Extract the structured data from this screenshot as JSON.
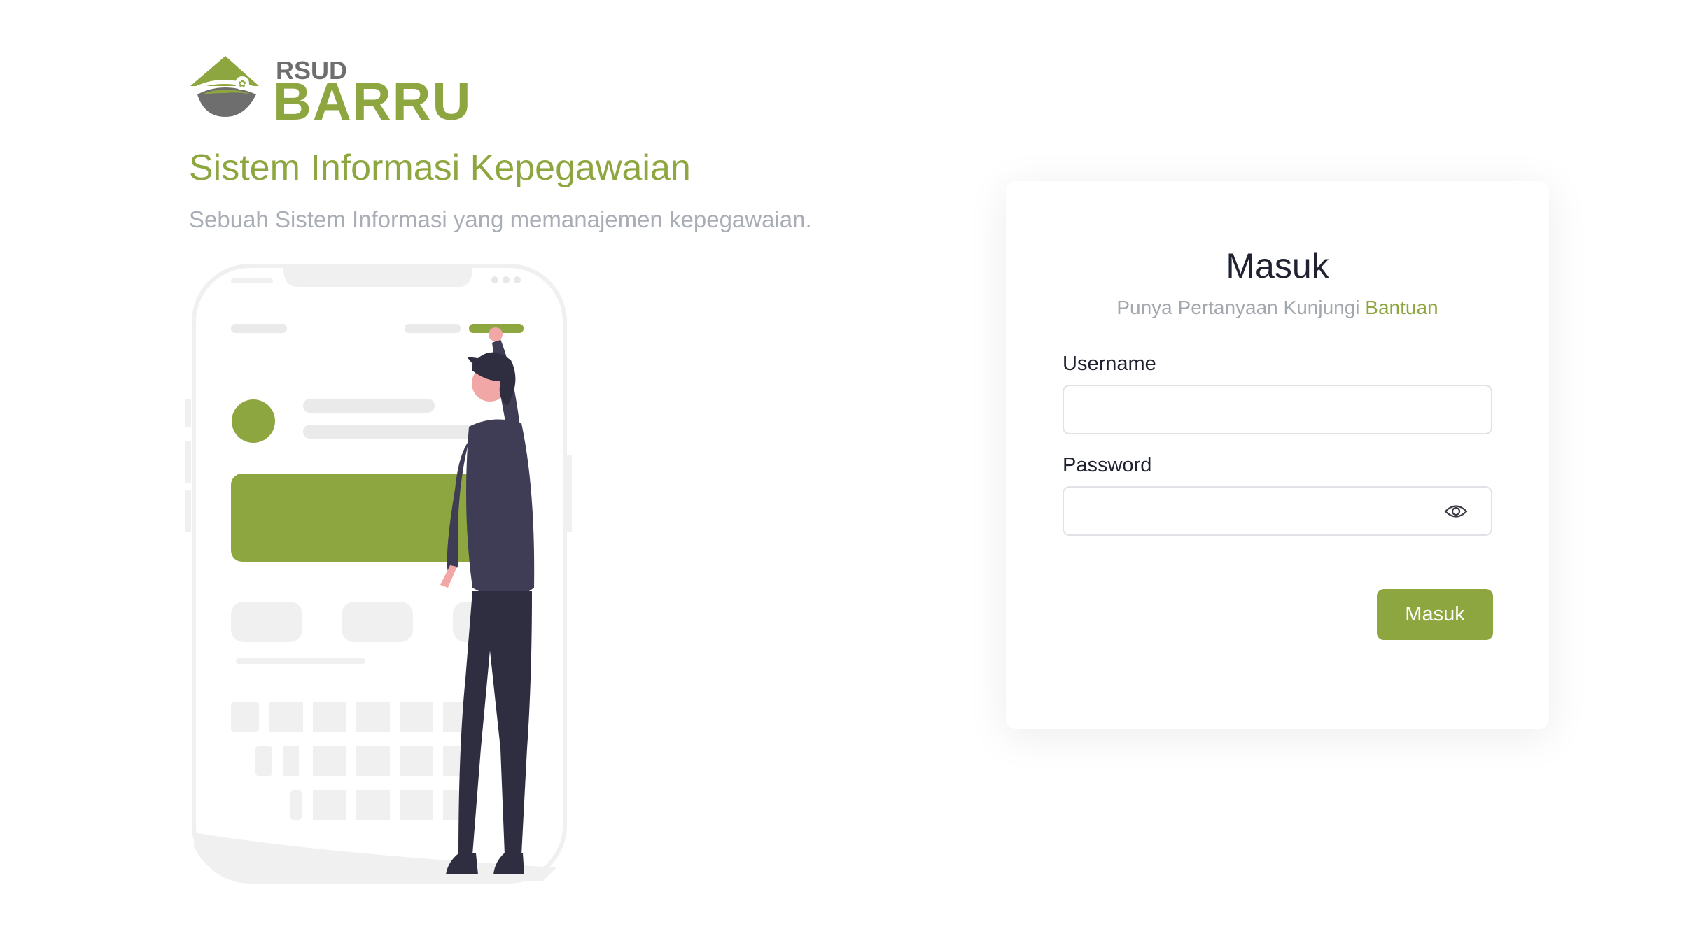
{
  "brand": {
    "logo_small_text": "RSUD",
    "logo_large_text": "BARRU",
    "logo_icon": "rsud-barru-emblem-icon",
    "accent_color": "#8ea63f",
    "gray_color": "#6e6e6e"
  },
  "hero": {
    "title": "Sistem Informasi Kepegawaian",
    "subtitle": "Sebuah Sistem Informasi yang memanajemen kepegawaian."
  },
  "login": {
    "heading": "Masuk",
    "help_text": "Punya Pertanyaan Kunjungi",
    "help_link": "Bantuan",
    "username_label": "Username",
    "username_value": "",
    "username_placeholder": "",
    "password_label": "Password",
    "password_value": "",
    "password_placeholder": "",
    "password_toggle_icon": "eye-icon",
    "submit_label": "Masuk"
  }
}
